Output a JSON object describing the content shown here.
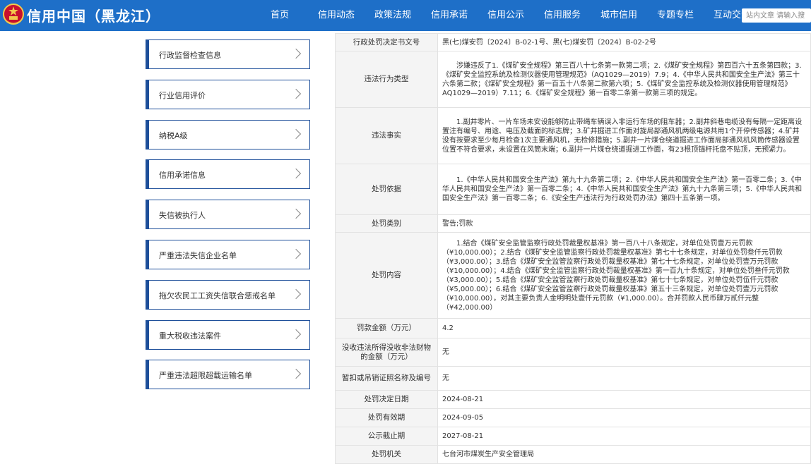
{
  "header": {
    "site_title": "信用中国（黑龙江）",
    "logo_icon": "national-emblem-icon",
    "nav": [
      "首页",
      "信用动态",
      "政策法规",
      "信用承诺",
      "信用公示",
      "信用服务",
      "城市信用",
      "专题专栏",
      "互动交流"
    ],
    "search_placeholder": "站内文章 请输入搜"
  },
  "sidebar": {
    "items": [
      {
        "label": "行政监督检查信息"
      },
      {
        "label": "行业信用评价"
      },
      {
        "label": "纳税A级"
      },
      {
        "label": "信用承诺信息"
      },
      {
        "label": "失信被执行人"
      },
      {
        "label": "严重违法失信企业名单"
      },
      {
        "label": "拖欠农民工工资失信联合惩戒名单"
      },
      {
        "label": "重大税收违法案件"
      },
      {
        "label": "严重违法超限超载运输名单"
      }
    ]
  },
  "detail": {
    "rows": [
      {
        "key": "行政处罚决定书文号",
        "value": "黑(七)煤安罚〔2024〕B-02-1号、黑(七)煤安罚〔2024〕B-02-2号"
      },
      {
        "key": "违法行为类型",
        "value": "涉嫌违反了1.《煤矿安全规程》第三百八十七条第一款第二项；2.《煤矿安全规程》第四百六十五条第四款；3.《煤矿安全监控系统及检测仪器使用管理规范》（AQ1029—2019）7.9；4.《中华人民共和国安全生产法》第三十六条第二款；《煤矿安全规程》第一百五十八条第二款第六项；5.《煤矿安全监控系统及检测仪器使用管理规范》AQ1029—2019）7.11；6.《煤矿安全规程》第一百零二条第一款第三项的规定。"
      },
      {
        "key": "违法事实",
        "value": "1.副井零片、一片车场未安设能够防止带绳车辆误入非运行车场的阻车器；2.副井斜巷电缆没有每隔一定距离设置注有编号、用途、电压及截面的标志牌；3.矿井掘进工作面对旋局部通风机两级电源共用1个开停传感器；4.矿井没有按要求至少每月检查1次主要通风机，无检修措施；5.副井一片煤仓绕道掘进工作面局部通风机风筒传感器设置位置不符合要求，未设置在风筒末端；6.副井一片煤仓绕道掘进工作面，有23根顶锚杆托盘不贴顶，无预紧力。"
      },
      {
        "key": "处罚依据",
        "value": "1.《中华人民共和国安全生产法》第九十九条第二项；2.《中华人民共和国安全生产法》第一百零二条；3.《中华人民共和国安全生产法》第一百零二条；4.《中华人民共和国安全生产法》第九十九条第三项；5.《中华人民共和国安全生产法》第一百零二条；6.《安全生产违法行为行政处罚办法》第四十五条第一项。"
      },
      {
        "key": "处罚类别",
        "value": "警告;罚款"
      },
      {
        "key": "处罚内容",
        "value": "1.结合《煤矿安全监管监察行政处罚裁量权基准》第一百八十八条规定，对单位处罚壹万元罚款（¥10,000.00）；2.结合《煤矿安全监管监察行政处罚裁量权基准》第七十七条规定，对单位处罚叁仟元罚款（¥3,000.00）；3.结合《煤矿安全监管监察行政处罚裁量权基准》第七十七条规定，对单位处罚壹万元罚款（¥10,000.00）；4.结合《煤矿安全监管监察行政处罚裁量权基准》第一百九十条规定，对单位处罚叁仟元罚款（¥3,000.00）；5.结合《煤矿安全监管监察行政处罚裁量权基准》第七十七条规定，对单位处罚伍仟元罚款（¥5,000.00）；6.结合《煤矿安全监管监察行政处罚裁量权基准》第五十三条规定，对单位处罚壹万元罚款（¥10,000.00），对其主要负责人金明明处壹仟元罚款（¥1,000.00）。合并罚款人民币肆万贰仟元整（¥42,000.00）"
      },
      {
        "key": "罚款金额（万元）",
        "value": "4.2"
      },
      {
        "key": "没收违法所得没收非法财物的金额（万元）",
        "value": "无"
      },
      {
        "key": "暂扣或吊销证照名称及编号",
        "value": "无"
      },
      {
        "key": "处罚决定日期",
        "value": "2024-08-21"
      },
      {
        "key": "处罚有效期",
        "value": "2024-09-05"
      },
      {
        "key": "公示截止期",
        "value": "2027-08-21"
      },
      {
        "key": "处罚机关",
        "value": "七台河市煤炭生产安全管理局"
      }
    ]
  }
}
